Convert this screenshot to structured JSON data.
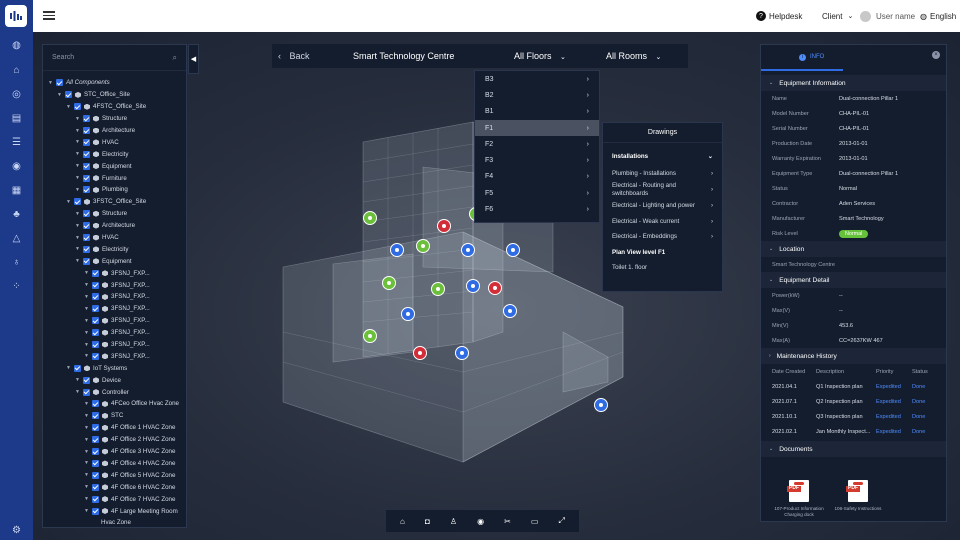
{
  "header": {
    "helpdesk": "Helpdesk",
    "client": "Client",
    "user": "User name",
    "language": "English"
  },
  "tree": {
    "search_placeholder": "Search",
    "nodes": [
      {
        "label": "All Components",
        "depth": 0,
        "arrow": true,
        "cube": false,
        "italic": true
      },
      {
        "label": "STC_Office_Site",
        "depth": 1,
        "arrow": true,
        "cube": true
      },
      {
        "label": "4FSTC_Office_Site",
        "depth": 2,
        "arrow": true,
        "cube": true
      },
      {
        "label": "Structure",
        "depth": 3,
        "arrow": true,
        "cube": true
      },
      {
        "label": "Architecture",
        "depth": 3,
        "arrow": true,
        "cube": true
      },
      {
        "label": "HVAC",
        "depth": 3,
        "arrow": true,
        "cube": true
      },
      {
        "label": "Electricity",
        "depth": 3,
        "arrow": true,
        "cube": true
      },
      {
        "label": "Equipment",
        "depth": 3,
        "arrow": true,
        "cube": true
      },
      {
        "label": "Furniture",
        "depth": 3,
        "arrow": true,
        "cube": true
      },
      {
        "label": "Plumbing",
        "depth": 3,
        "arrow": true,
        "cube": true
      },
      {
        "label": "3FSTC_Office_Site",
        "depth": 2,
        "arrow": true,
        "cube": true
      },
      {
        "label": "Structure",
        "depth": 3,
        "arrow": true,
        "cube": true
      },
      {
        "label": "Architecture",
        "depth": 3,
        "arrow": true,
        "cube": true
      },
      {
        "label": "HVAC",
        "depth": 3,
        "arrow": true,
        "cube": true
      },
      {
        "label": "Electricity",
        "depth": 3,
        "arrow": true,
        "cube": true
      },
      {
        "label": "Equipment",
        "depth": 3,
        "arrow": true,
        "cube": true
      },
      {
        "label": "3FSNJ_FXP...",
        "depth": 4,
        "arrow": true,
        "cube": true
      },
      {
        "label": "3FSNJ_FXP...",
        "depth": 4,
        "arrow": true,
        "cube": true
      },
      {
        "label": "3FSNJ_FXP...",
        "depth": 4,
        "arrow": true,
        "cube": true
      },
      {
        "label": "3FSNJ_FXP...",
        "depth": 4,
        "arrow": true,
        "cube": true
      },
      {
        "label": "3FSNJ_FXP...",
        "depth": 4,
        "arrow": true,
        "cube": true
      },
      {
        "label": "3FSNJ_FXP...",
        "depth": 4,
        "arrow": true,
        "cube": true
      },
      {
        "label": "3FSNJ_FXP...",
        "depth": 4,
        "arrow": true,
        "cube": true
      },
      {
        "label": "3FSNJ_FXP...",
        "depth": 4,
        "arrow": true,
        "cube": true
      },
      {
        "label": "IoT Systems",
        "depth": 2,
        "arrow": true,
        "cube": true
      },
      {
        "label": "Device",
        "depth": 3,
        "arrow": true,
        "cube": true
      },
      {
        "label": "Controller",
        "depth": 3,
        "arrow": true,
        "cube": true
      },
      {
        "label": "4FCeo Office Hvac Zone",
        "depth": 4,
        "arrow": true,
        "cube": true
      },
      {
        "label": "STC",
        "depth": 4,
        "arrow": true,
        "cube": true
      },
      {
        "label": "4F Office 1 HVAC Zone",
        "depth": 4,
        "arrow": true,
        "cube": true
      },
      {
        "label": "4F Office 2 HVAC Zone",
        "depth": 4,
        "arrow": true,
        "cube": true
      },
      {
        "label": "4F Office 3 HVAC Zone",
        "depth": 4,
        "arrow": true,
        "cube": true
      },
      {
        "label": "4F Office 4 HVAC Zone",
        "depth": 4,
        "arrow": true,
        "cube": true
      },
      {
        "label": "4F Office 5 HVAC Zone",
        "depth": 4,
        "arrow": true,
        "cube": true
      },
      {
        "label": "4F Office 6 HVAC Zone",
        "depth": 4,
        "arrow": true,
        "cube": true
      },
      {
        "label": "4F Office 7 HVAC Zone",
        "depth": 4,
        "arrow": true,
        "cube": true
      },
      {
        "label": "4F Large Meeting Room",
        "depth": 4,
        "arrow": true,
        "cube": true
      },
      {
        "label": "Hvac Zone",
        "depth": 5,
        "arrow": false,
        "cube": false
      }
    ]
  },
  "floorbar": {
    "back": "Back",
    "title": "Smart Technology Centre",
    "floors": "All Floors",
    "rooms": "All Rooms"
  },
  "floors": {
    "items": [
      "B3",
      "B2",
      "B1",
      "F1",
      "F2",
      "F3",
      "F4",
      "F5",
      "F6"
    ],
    "selected": "F1"
  },
  "drawings": {
    "title": "Drawings",
    "items": [
      {
        "label": "Installations",
        "bold": true,
        "arrow": "⌄"
      },
      {
        "label": "Plumbing - Installations",
        "bold": false,
        "arrow": "›"
      },
      {
        "label": "Electrical - Routing and switchboards",
        "bold": false,
        "arrow": "›"
      },
      {
        "label": "Electrical - Lighting and power",
        "bold": false,
        "arrow": "›"
      },
      {
        "label": "Electrical - Weak current",
        "bold": false,
        "arrow": "›"
      },
      {
        "label": "Electrical - Embeddings",
        "bold": false,
        "arrow": "›"
      },
      {
        "label": "Plan View level F1",
        "bold": true,
        "arrow": ""
      },
      {
        "label": "Toilet 1. floor",
        "bold": false,
        "arrow": ""
      }
    ]
  },
  "info": {
    "tab": "INFO",
    "equipment_title": "Equipment Information",
    "equipment": [
      {
        "k": "Name",
        "v": "Dual-connection Pillar 1"
      },
      {
        "k": "Model Number",
        "v": "CHA-PIL-01"
      },
      {
        "k": "Serial Number",
        "v": "CHA-PIL-01"
      },
      {
        "k": "Production Date",
        "v": "2013-01-01"
      },
      {
        "k": "Warranty Expiration",
        "v": "2013-01-01"
      },
      {
        "k": "Equipment Type",
        "v": "Dual-connection Pillar 1"
      },
      {
        "k": "Status",
        "v": "Normal"
      },
      {
        "k": "Contractor",
        "v": "Aden Services"
      },
      {
        "k": "Manufacturer",
        "v": "Smart Technology"
      },
      {
        "k": "Risk Level",
        "v": "Normal"
      }
    ],
    "location_title": "Location",
    "location_value": "Smart Technology Centre",
    "detail_title": "Equipment Detail",
    "detail": [
      {
        "k": "Power(kW)",
        "v": "--"
      },
      {
        "k": "Max(V)",
        "v": "--"
      },
      {
        "k": "Min(V)",
        "v": "453.6"
      },
      {
        "k": "Max(A)",
        "v": "CC=2637KW  467"
      }
    ],
    "maintenance_title": "Maintenance History",
    "maintenance_headers": [
      "Date Created",
      "Description",
      "Priority",
      "Status"
    ],
    "maintenance": [
      [
        "2021.04.1",
        "Q1 Inspection plan",
        "Expedited",
        "Done"
      ],
      [
        "2021.07.1",
        "Q2 Inspection plan",
        "Expedited",
        "Done"
      ],
      [
        "2021.10.1",
        "Q3 Inspection plan",
        "Expedited",
        "Done"
      ],
      [
        "2021.02.1",
        "Jan Monthly Inspect...",
        "Expedited",
        "Done"
      ]
    ],
    "documents_title": "Documents",
    "documents": [
      {
        "name": "107-Product Information Charging dock",
        "badge": "PDF"
      },
      {
        "name": "106-Safety Instructions",
        "badge": "PDF"
      }
    ]
  },
  "colors": {
    "accent": "#2f6be3",
    "nav": "#1d3a8a",
    "panel": "#141d2d",
    "normal_badge": "#66c23a",
    "alert": "#d22e3a",
    "iot": "#6bbf3b"
  },
  "icons": [
    "home-icon",
    "camera-icon",
    "person-icon",
    "eye-icon",
    "scissors-icon",
    "ruler-icon",
    "fullscreen-icon"
  ]
}
